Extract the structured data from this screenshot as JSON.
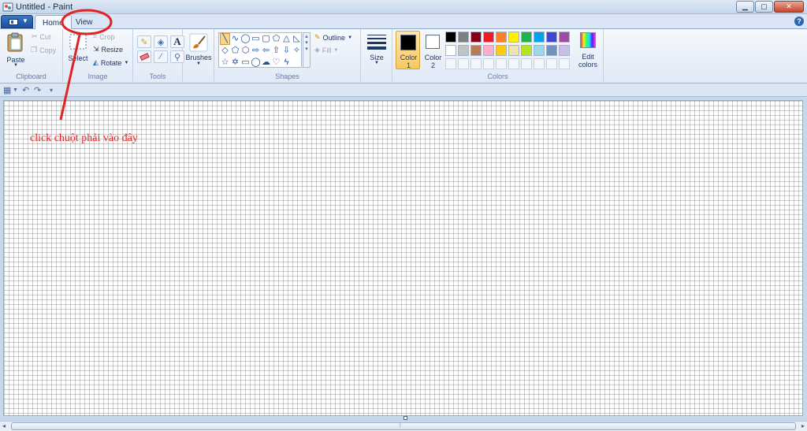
{
  "window": {
    "title": "Untitled - Paint",
    "minimize": "▁",
    "maximize": "▢",
    "close": "✕"
  },
  "tabs": {
    "home": "Home",
    "view": "View",
    "help": "?"
  },
  "clipboard": {
    "paste": "Paste",
    "cut": "Cut",
    "copy": "Copy",
    "group": "Clipboard"
  },
  "image": {
    "select": "Select",
    "crop": "Crop",
    "resize": "Resize",
    "rotate": "Rotate",
    "group": "Image"
  },
  "tools": {
    "group": "Tools"
  },
  "brushes": {
    "label": "Brushes"
  },
  "shapes": {
    "outline": "Outline",
    "fill": "Fill",
    "group": "Shapes"
  },
  "size": {
    "label": "Size"
  },
  "colors": {
    "color1": "Color",
    "color1_num": "1",
    "color2": "Color",
    "color2_num": "2",
    "edit_line1": "Edit",
    "edit_line2": "colors",
    "group": "Colors",
    "color1_value": "#000000",
    "color2_value": "#ffffff",
    "palette": [
      "#000000",
      "#7f7f7f",
      "#880015",
      "#ed1c24",
      "#ff7f27",
      "#fff200",
      "#22b14c",
      "#00a2e8",
      "#3f48cc",
      "#a349a4",
      "#ffffff",
      "#c3c3c3",
      "#b97a57",
      "#ffaec9",
      "#ffc90e",
      "#efe4b0",
      "#b5e61d",
      "#99d9ea",
      "#7092be",
      "#c8bfe7",
      "",
      "",
      "",
      "",
      "",
      "",
      "",
      "",
      "",
      ""
    ]
  },
  "annotation": {
    "text": "click chuột phải vào đây",
    "color": "#e02424"
  }
}
